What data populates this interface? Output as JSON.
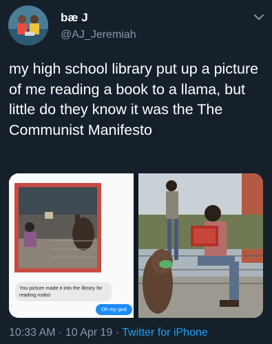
{
  "author": {
    "display_name": "bæ J",
    "handle": "@AJ_Jeremiah"
  },
  "tweet": {
    "text": "my high school library put up a picture of me reading a book to a llama, but little do they know it was the The Communist Manifesto"
  },
  "media": {
    "left": {
      "received_message": "You picture made it into the library for reading rodeo",
      "sent_message": "Oh my god"
    }
  },
  "meta": {
    "time": "10:33 AM",
    "separator_1": " · ",
    "date": "10 Apr 19",
    "separator_2": " · ",
    "client": "Twitter for iPhone"
  },
  "colors": {
    "background": "#15202b",
    "secondary_text": "#8899a6",
    "link": "#1da1f2",
    "imessage_blue": "#1d8cf8"
  },
  "icons": {
    "menu": "chevron-down-icon"
  }
}
